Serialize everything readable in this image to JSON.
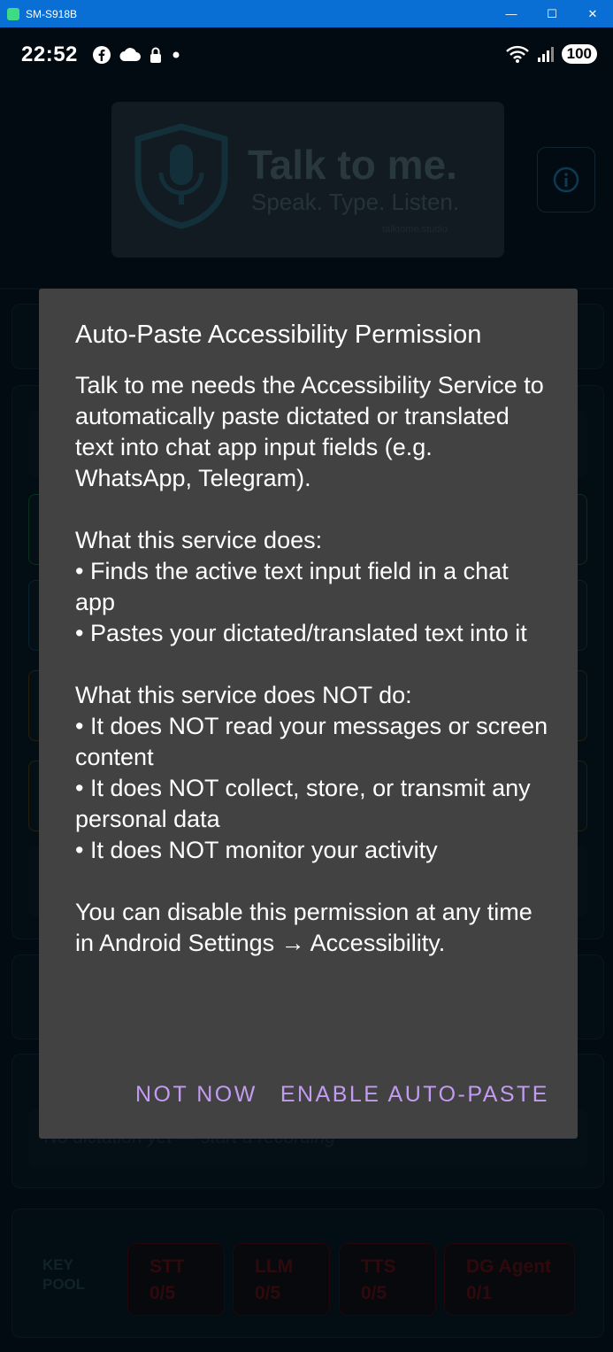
{
  "window": {
    "title": "SM-S918B",
    "min_icon": "minimize-icon",
    "max_icon": "maximize-icon",
    "close_icon": "close-icon"
  },
  "statusbar": {
    "time": "22:52",
    "battery": "100"
  },
  "background_app": {
    "logo_title": "Talk to me.",
    "logo_subtitle": "Speak. Type. Listen.",
    "logo_url": "talktome.studio",
    "placeholder_text": "No dictation yet — start a recording",
    "key_pool": {
      "label_line1": "KEY",
      "label_line2": "POOL",
      "items": [
        {
          "name": "STT",
          "value": "0/5"
        },
        {
          "name": "LLM",
          "value": "0/5"
        },
        {
          "name": "TTS",
          "value": "0/5"
        },
        {
          "name": "DG Agent",
          "value": "0/1"
        }
      ]
    }
  },
  "dialog": {
    "title": "Auto-Paste Accessibility Permission",
    "body": "Talk to me needs the Accessibility Service to automatically paste dictated or translated text into chat app input fields (e.g. WhatsApp, Telegram).\n\nWhat this service does:\n• Finds the active text input field in a chat app\n• Pastes your dictated/translated text into it\n\nWhat this service does NOT do:\n• It does NOT read your messages or screen content\n• It does NOT collect, store, or transmit any personal data\n• It does NOT monitor your activity\n\nYou can disable this permission at any time in Android Settings → Accessibility.",
    "negative_button": "NOT NOW",
    "positive_button": "ENABLE AUTO-PASTE"
  },
  "colors": {
    "dialog_bg": "#424242",
    "accent": "#c39bf2",
    "titlebar": "#0a6fd4"
  }
}
